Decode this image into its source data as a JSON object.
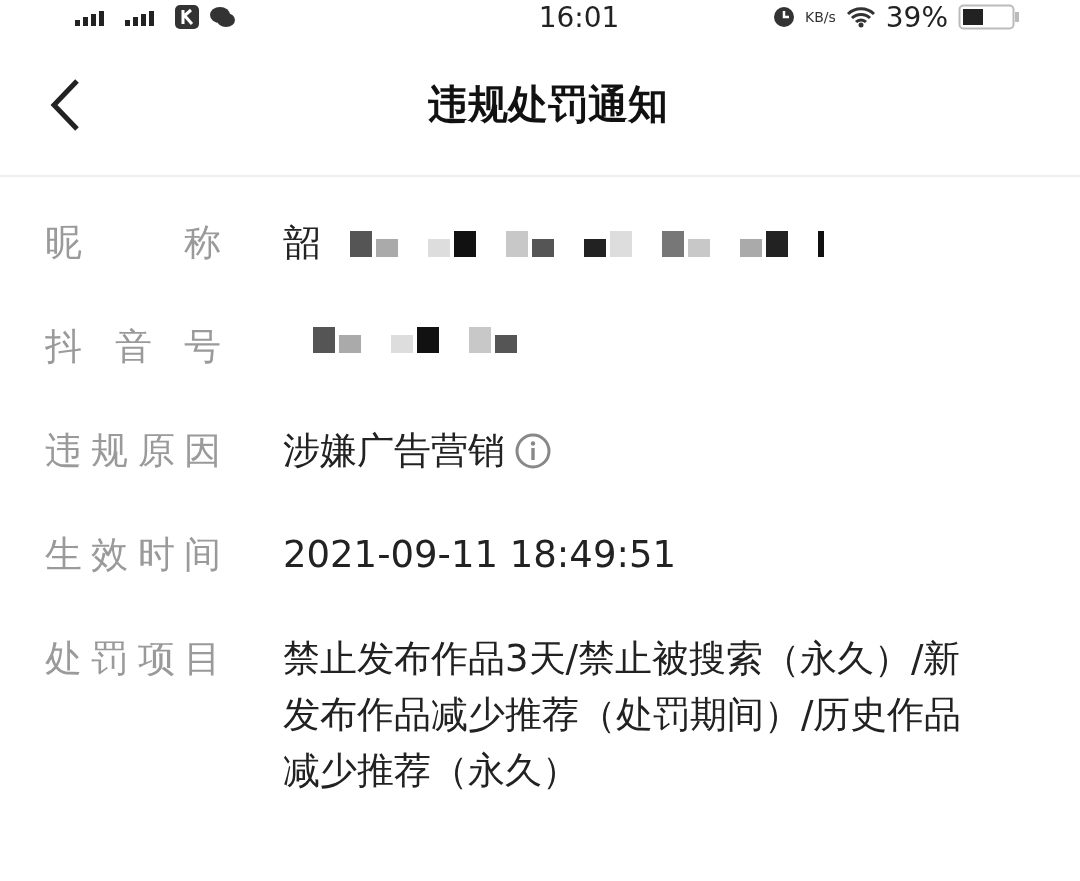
{
  "status_bar": {
    "time": "16:01",
    "speed_unit": "KB/s",
    "battery": "39%"
  },
  "header": {
    "title": "违规处罚通知"
  },
  "fields": [
    {
      "label": "昵称",
      "value": "韶",
      "redacted": true,
      "info": false
    },
    {
      "label": "抖音号",
      "redacted": true,
      "info": false
    },
    {
      "label": "违规原因",
      "value": "涉嫌广告营销",
      "redacted": false,
      "info": true
    },
    {
      "label": "生效时间",
      "value": "2021-09-11 18:49:51",
      "redacted": false,
      "info": false
    },
    {
      "label": "处罚项目",
      "value": "禁止发布作品3天/禁止被搜索（永久）/新发布作品减少推荐（处罚期间）/历史作品减少推荐（永久）",
      "redacted": false,
      "info": false
    }
  ]
}
